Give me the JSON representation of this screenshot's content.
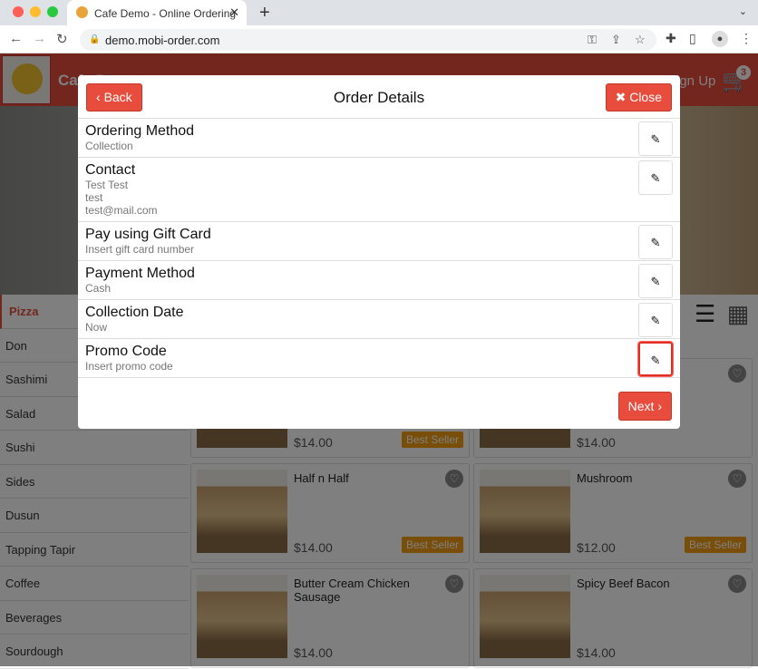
{
  "browser": {
    "tab_title": "Cafe Demo - Online Ordering",
    "url": "demo.mobi-order.com"
  },
  "header": {
    "brand": "Cafe Demo",
    "signup": "Sign Up",
    "cart_count": "3"
  },
  "sidebar": {
    "categories": [
      "Pizza",
      "Don",
      "Sashimi",
      "Salad",
      "Sushi",
      "Sides",
      "Dusun",
      "Tapping Tapir",
      "Coffee",
      "Beverages",
      "Sourdough"
    ],
    "active": "Pizza"
  },
  "products": [
    {
      "name": "",
      "price": "$14.00",
      "badge": "Best Seller"
    },
    {
      "name": "",
      "price": "$14.00",
      "badge": ""
    },
    {
      "name": "Half n Half",
      "price": "$14.00",
      "badge": "Best Seller"
    },
    {
      "name": "Mushroom",
      "price": "$12.00",
      "badge": "Best Seller"
    },
    {
      "name": "Butter Cream Chicken Sausage",
      "price": "$14.00",
      "badge": ""
    },
    {
      "name": "Spicy Beef Bacon",
      "price": "$14.00",
      "badge": ""
    }
  ],
  "modal": {
    "title": "Order Details",
    "back_label": "Back",
    "close_label": "Close",
    "next_label": "Next",
    "rows": [
      {
        "title": "Ordering Method",
        "lines": [
          "Collection"
        ]
      },
      {
        "title": "Contact",
        "lines": [
          "Test Test",
          "test",
          "test@mail.com"
        ]
      },
      {
        "title": "Pay using Gift Card",
        "lines": [
          "Insert gift card number"
        ]
      },
      {
        "title": "Payment Method",
        "lines": [
          "Cash"
        ]
      },
      {
        "title": "Collection Date",
        "lines": [
          "Now"
        ]
      },
      {
        "title": "Promo Code",
        "lines": [
          "Insert promo code"
        ]
      }
    ]
  },
  "colors": {
    "accent": "#e74c3c",
    "badge": "#f39c12",
    "highlight": "#e03020"
  }
}
